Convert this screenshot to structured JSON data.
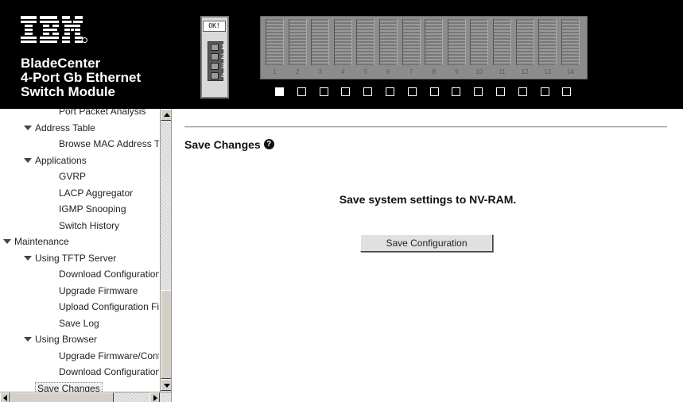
{
  "header": {
    "logo_text": "IBM",
    "brand_lines": [
      "BladeCenter",
      "4-Port Gb Ethernet",
      "Switch Module"
    ],
    "module": {
      "status_label": "OK!",
      "port_numbers": [
        "1",
        "2",
        "3",
        "4"
      ]
    },
    "bays": [
      "1",
      "2",
      "3",
      "4",
      "5",
      "6",
      "7",
      "8",
      "9",
      "10",
      "11",
      "12",
      "13",
      "14"
    ],
    "selected_bay_index": 0
  },
  "nav": {
    "items": [
      {
        "label": "Port Packet Analysis",
        "level": 3,
        "expanded": null,
        "selected": false
      },
      {
        "label": "Address Table",
        "level": 2,
        "expanded": true,
        "selected": false
      },
      {
        "label": "Browse MAC Address Table",
        "level": 3,
        "expanded": null,
        "selected": false
      },
      {
        "label": "Applications",
        "level": 2,
        "expanded": true,
        "selected": false
      },
      {
        "label": "GVRP",
        "level": 3,
        "expanded": null,
        "selected": false
      },
      {
        "label": "LACP Aggregator",
        "level": 3,
        "expanded": null,
        "selected": false
      },
      {
        "label": "IGMP Snooping",
        "level": 3,
        "expanded": null,
        "selected": false
      },
      {
        "label": "Switch History",
        "level": 3,
        "expanded": null,
        "selected": false
      },
      {
        "label": "Maintenance",
        "level": 1,
        "expanded": true,
        "selected": false
      },
      {
        "label": "Using TFTP Server",
        "level": 2,
        "expanded": true,
        "selected": false
      },
      {
        "label": "Download Configuration",
        "level": 3,
        "expanded": null,
        "selected": false
      },
      {
        "label": "Upgrade Firmware",
        "level": 3,
        "expanded": null,
        "selected": false
      },
      {
        "label": "Upload Configuration File",
        "level": 3,
        "expanded": null,
        "selected": false
      },
      {
        "label": "Save Log",
        "level": 3,
        "expanded": null,
        "selected": false
      },
      {
        "label": "Using Browser",
        "level": 2,
        "expanded": true,
        "selected": false
      },
      {
        "label": "Upgrade Firmware/Config",
        "level": 3,
        "expanded": null,
        "selected": false
      },
      {
        "label": "Download Configuration",
        "level": 3,
        "expanded": null,
        "selected": false
      },
      {
        "label": "Save Changes",
        "level": 2,
        "expanded": null,
        "selected": true
      }
    ]
  },
  "main": {
    "title": "Save Changes",
    "help_icon": "help-icon",
    "description": "Save system settings to NV-RAM.",
    "save_button_label": "Save Configuration"
  },
  "colors": {
    "header_bg": "#000000",
    "content_bg": "#ffffff",
    "button_bg": "#e0e0e0"
  }
}
